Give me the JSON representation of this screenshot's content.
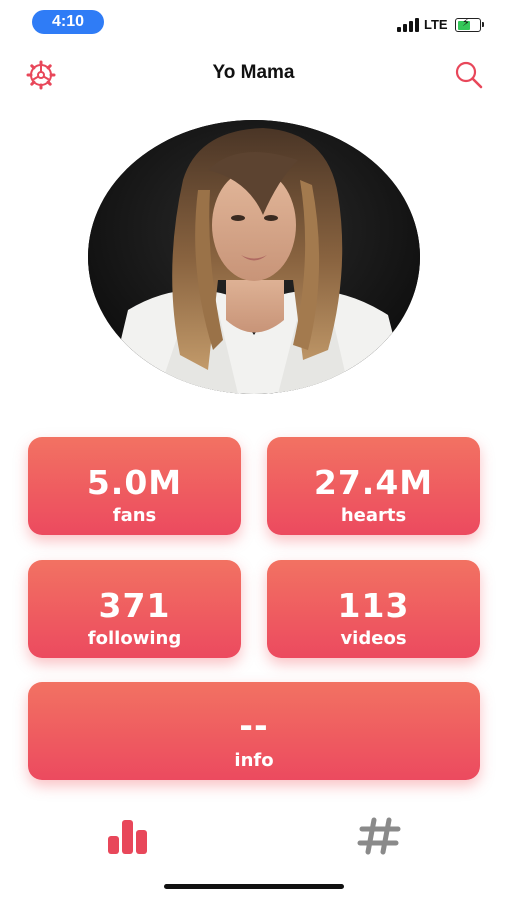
{
  "status_bar": {
    "time": "4:10",
    "network": "LTE"
  },
  "nav": {
    "title": "Yo Mama",
    "settings_icon": "gear-icon",
    "search_icon": "search-icon",
    "accent_color": "#e8475a"
  },
  "profile": {
    "avatar": "profile-photo"
  },
  "stats": {
    "fans": {
      "value": "5.0M",
      "label": "fans"
    },
    "hearts": {
      "value": "27.4M",
      "label": "hearts"
    },
    "following": {
      "value": "371",
      "label": "following"
    },
    "videos": {
      "value": "113",
      "label": "videos"
    },
    "info": {
      "value": "--",
      "label": "info"
    }
  },
  "tab_bar": {
    "tabs": [
      {
        "icon": "bar-chart-icon",
        "active": true,
        "color": "#e8475a"
      },
      {
        "icon": "hashtag-icon",
        "active": false,
        "color": "#8a8a8a"
      }
    ]
  },
  "colors": {
    "card_top": "#f27262",
    "card_bottom": "#ec4a5f",
    "time_pill": "#2f7cf6"
  }
}
